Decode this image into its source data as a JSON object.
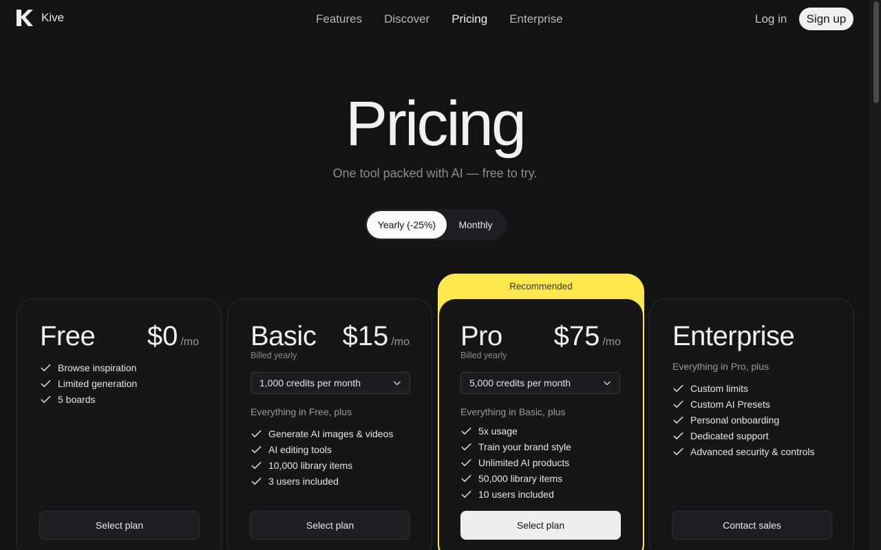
{
  "header": {
    "brand": "Kive",
    "nav": [
      "Features",
      "Discover",
      "Pricing",
      "Enterprise"
    ],
    "active_nav": "Pricing",
    "login": "Log in",
    "signup": "Sign up"
  },
  "hero": {
    "title": "Pricing",
    "subtitle": "One tool packed with AI — free to try."
  },
  "billing_toggle": {
    "options": [
      "Yearly (-25%)",
      "Monthly"
    ],
    "selected": "Yearly (-25%)"
  },
  "recommended_label": "Recommended",
  "plans": [
    {
      "name": "Free",
      "price": "$0",
      "period": "/mo",
      "features": [
        "Browse inspiration",
        "Limited generation",
        "5 boards"
      ],
      "cta": "Select plan"
    },
    {
      "name": "Basic",
      "price": "$15",
      "period": "/mo",
      "billed": "Billed yearly",
      "credits": "1,000 credits per month",
      "intro": "Everything in Free, plus",
      "features": [
        "Generate AI images & videos",
        "AI editing tools",
        "10,000 library items",
        "3 users included"
      ],
      "cta": "Select plan"
    },
    {
      "name": "Pro",
      "price": "$75",
      "period": "/mo",
      "billed": "Billed yearly",
      "credits": "5,000 credits per month",
      "intro": "Everything in Basic, plus",
      "features": [
        "5x usage",
        "Train your brand style",
        "Unlimited AI products",
        "50,000 library items",
        "10 users included"
      ],
      "cta": "Select plan"
    },
    {
      "name": "Enterprise",
      "intro": "Everything in Pro, plus",
      "features": [
        "Custom limits",
        "Custom AI Presets",
        "Personal onboarding",
        "Dedicated support",
        "Advanced security & controls"
      ],
      "cta": "Contact sales"
    }
  ],
  "icons": {
    "logo": "kive-logo-icon",
    "check": "check-icon",
    "chevron": "chevron-down-icon"
  },
  "colors": {
    "background": "#131314",
    "recommended_accent": "#fde94e",
    "primary_button": "#eeeeee"
  }
}
